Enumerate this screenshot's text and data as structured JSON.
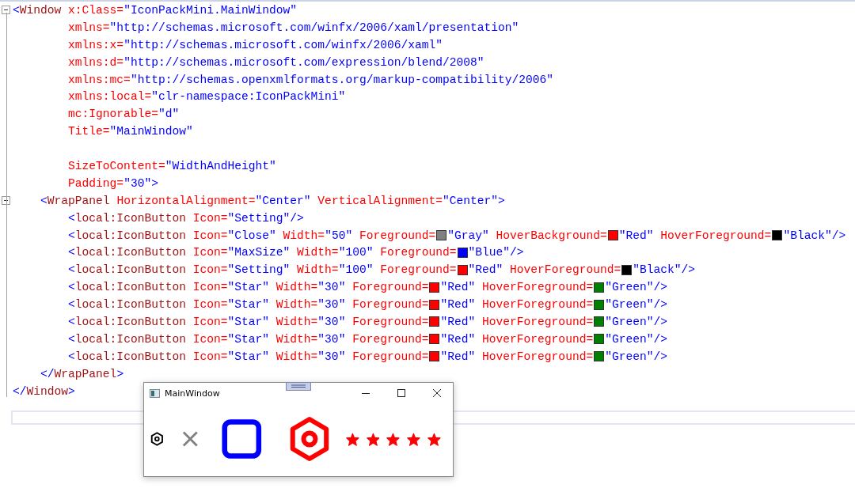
{
  "editor": {
    "lines": [
      {
        "kind": "code",
        "foldable": true,
        "tokens": [
          {
            "kind": "punct",
            "text": "<"
          },
          {
            "kind": "element",
            "text": "Window"
          },
          {
            "kind": "attr",
            "text": " x:Class="
          },
          {
            "kind": "value",
            "text": "\"IconPackMini.MainWindow\""
          }
        ]
      },
      {
        "kind": "code",
        "foldable": false,
        "tokens": [
          {
            "kind": "attr",
            "text": "        xmlns="
          },
          {
            "kind": "value",
            "text": "\"http://schemas.microsoft.com/winfx/2006/xaml/presentation\""
          }
        ]
      },
      {
        "kind": "code",
        "foldable": false,
        "tokens": [
          {
            "kind": "attr",
            "text": "        xmlns:x="
          },
          {
            "kind": "value",
            "text": "\"http://schemas.microsoft.com/winfx/2006/xaml\""
          }
        ]
      },
      {
        "kind": "code",
        "foldable": false,
        "tokens": [
          {
            "kind": "attr",
            "text": "        xmlns:d="
          },
          {
            "kind": "value",
            "text": "\"http://schemas.microsoft.com/expression/blend/2008\""
          }
        ]
      },
      {
        "kind": "code",
        "foldable": false,
        "tokens": [
          {
            "kind": "attr",
            "text": "        xmlns:mc="
          },
          {
            "kind": "value",
            "text": "\"http://schemas.openxmlformats.org/markup-compatibility/2006\""
          }
        ]
      },
      {
        "kind": "code",
        "foldable": false,
        "tokens": [
          {
            "kind": "attr",
            "text": "        xmlns:local="
          },
          {
            "kind": "value",
            "text": "\"clr-namespace:IconPackMini\""
          }
        ]
      },
      {
        "kind": "code",
        "foldable": false,
        "tokens": [
          {
            "kind": "attr",
            "text": "        mc:Ignorable="
          },
          {
            "kind": "value",
            "text": "\"d\""
          }
        ]
      },
      {
        "kind": "code",
        "foldable": false,
        "tokens": [
          {
            "kind": "attr",
            "text": "        Title="
          },
          {
            "kind": "value",
            "text": "\"MainWindow\""
          }
        ]
      },
      {
        "kind": "blank"
      },
      {
        "kind": "code",
        "foldable": false,
        "tokens": [
          {
            "kind": "attr",
            "text": "        SizeToContent="
          },
          {
            "kind": "value",
            "text": "\"WidthAndHeight\""
          }
        ]
      },
      {
        "kind": "code",
        "foldable": false,
        "tokens": [
          {
            "kind": "attr",
            "text": "        Padding="
          },
          {
            "kind": "value",
            "text": "\"30\""
          },
          {
            "kind": "punct",
            "text": ">"
          }
        ]
      },
      {
        "kind": "code",
        "foldable": true,
        "tokens": [
          {
            "kind": "punct",
            "text": "    <"
          },
          {
            "kind": "element",
            "text": "WrapPanel"
          },
          {
            "kind": "attr",
            "text": " HorizontalAlignment="
          },
          {
            "kind": "value",
            "text": "\"Center\""
          },
          {
            "kind": "attr",
            "text": " VerticalAlignment="
          },
          {
            "kind": "value",
            "text": "\"Center\""
          },
          {
            "kind": "punct",
            "text": ">"
          }
        ]
      },
      {
        "kind": "code",
        "foldable": false,
        "tokens": [
          {
            "kind": "punct",
            "text": "        <"
          },
          {
            "kind": "element",
            "text": "local:IconButton"
          },
          {
            "kind": "attr",
            "text": " Icon="
          },
          {
            "kind": "value",
            "text": "\"Setting\""
          },
          {
            "kind": "punct",
            "text": "/>"
          }
        ]
      },
      {
        "kind": "code",
        "foldable": false,
        "tokens": [
          {
            "kind": "punct",
            "text": "        <"
          },
          {
            "kind": "element",
            "text": "local:IconButton"
          },
          {
            "kind": "attr",
            "text": " Icon="
          },
          {
            "kind": "value",
            "text": "\"Close\""
          },
          {
            "kind": "attr",
            "text": " Width="
          },
          {
            "kind": "value",
            "text": "\"50\""
          },
          {
            "kind": "attr",
            "text": " Foreground="
          },
          {
            "kind": "swatch",
            "color": "#808080"
          },
          {
            "kind": "value",
            "text": "\"Gray\""
          },
          {
            "kind": "attr",
            "text": " HoverBackground="
          },
          {
            "kind": "swatch",
            "color": "#ff0000"
          },
          {
            "kind": "value",
            "text": "\"Red\""
          },
          {
            "kind": "attr",
            "text": " HoverForeground="
          },
          {
            "kind": "swatch",
            "color": "#000000"
          },
          {
            "kind": "value",
            "text": "\"Black\""
          },
          {
            "kind": "punct",
            "text": "/>"
          }
        ]
      },
      {
        "kind": "code",
        "foldable": false,
        "tokens": [
          {
            "kind": "punct",
            "text": "        <"
          },
          {
            "kind": "element",
            "text": "local:IconButton"
          },
          {
            "kind": "attr",
            "text": " Icon="
          },
          {
            "kind": "value",
            "text": "\"MaxSize\""
          },
          {
            "kind": "attr",
            "text": " Width="
          },
          {
            "kind": "value",
            "text": "\"100\""
          },
          {
            "kind": "attr",
            "text": " Foreground="
          },
          {
            "kind": "swatch",
            "color": "#0000ff"
          },
          {
            "kind": "value",
            "text": "\"Blue\""
          },
          {
            "kind": "punct",
            "text": "/>"
          }
        ]
      },
      {
        "kind": "code",
        "foldable": false,
        "tokens": [
          {
            "kind": "punct",
            "text": "        <"
          },
          {
            "kind": "element",
            "text": "local:IconButton"
          },
          {
            "kind": "attr",
            "text": " Icon="
          },
          {
            "kind": "value",
            "text": "\"Setting\""
          },
          {
            "kind": "attr",
            "text": " Width="
          },
          {
            "kind": "value",
            "text": "\"100\""
          },
          {
            "kind": "attr",
            "text": " Foreground="
          },
          {
            "kind": "swatch",
            "color": "#ff0000"
          },
          {
            "kind": "value",
            "text": "\"Red\""
          },
          {
            "kind": "attr",
            "text": " HoverForeground="
          },
          {
            "kind": "swatch",
            "color": "#000000"
          },
          {
            "kind": "value",
            "text": "\"Black\""
          },
          {
            "kind": "punct",
            "text": "/>"
          }
        ]
      },
      {
        "kind": "code",
        "foldable": false,
        "tokens": [
          {
            "kind": "punct",
            "text": "        <"
          },
          {
            "kind": "element",
            "text": "local:IconButton"
          },
          {
            "kind": "attr",
            "text": " Icon="
          },
          {
            "kind": "value",
            "text": "\"Star\""
          },
          {
            "kind": "attr",
            "text": " Width="
          },
          {
            "kind": "value",
            "text": "\"30\""
          },
          {
            "kind": "attr",
            "text": " Foreground="
          },
          {
            "kind": "swatch",
            "color": "#ff0000"
          },
          {
            "kind": "value",
            "text": "\"Red\""
          },
          {
            "kind": "attr",
            "text": " HoverForeground="
          },
          {
            "kind": "swatch",
            "color": "#008000"
          },
          {
            "kind": "value",
            "text": "\"Green\""
          },
          {
            "kind": "punct",
            "text": "/>"
          }
        ]
      },
      {
        "kind": "code",
        "foldable": false,
        "tokens": [
          {
            "kind": "punct",
            "text": "        <"
          },
          {
            "kind": "element",
            "text": "local:IconButton"
          },
          {
            "kind": "attr",
            "text": " Icon="
          },
          {
            "kind": "value",
            "text": "\"Star\""
          },
          {
            "kind": "attr",
            "text": " Width="
          },
          {
            "kind": "value",
            "text": "\"30\""
          },
          {
            "kind": "attr",
            "text": " Foreground="
          },
          {
            "kind": "swatch",
            "color": "#ff0000"
          },
          {
            "kind": "value",
            "text": "\"Red\""
          },
          {
            "kind": "attr",
            "text": " HoverForeground="
          },
          {
            "kind": "swatch",
            "color": "#008000"
          },
          {
            "kind": "value",
            "text": "\"Green\""
          },
          {
            "kind": "punct",
            "text": "/>"
          }
        ]
      },
      {
        "kind": "code",
        "foldable": false,
        "tokens": [
          {
            "kind": "punct",
            "text": "        <"
          },
          {
            "kind": "element",
            "text": "local:IconButton"
          },
          {
            "kind": "attr",
            "text": " Icon="
          },
          {
            "kind": "value",
            "text": "\"Star\""
          },
          {
            "kind": "attr",
            "text": " Width="
          },
          {
            "kind": "value",
            "text": "\"30\""
          },
          {
            "kind": "attr",
            "text": " Foreground="
          },
          {
            "kind": "swatch",
            "color": "#ff0000"
          },
          {
            "kind": "value",
            "text": "\"Red\""
          },
          {
            "kind": "attr",
            "text": " HoverForeground="
          },
          {
            "kind": "swatch",
            "color": "#008000"
          },
          {
            "kind": "value",
            "text": "\"Green\""
          },
          {
            "kind": "punct",
            "text": "/>"
          }
        ]
      },
      {
        "kind": "code",
        "foldable": false,
        "tokens": [
          {
            "kind": "punct",
            "text": "        <"
          },
          {
            "kind": "element",
            "text": "local:IconButton"
          },
          {
            "kind": "attr",
            "text": " Icon="
          },
          {
            "kind": "value",
            "text": "\"Star\""
          },
          {
            "kind": "attr",
            "text": " Width="
          },
          {
            "kind": "value",
            "text": "\"30\""
          },
          {
            "kind": "attr",
            "text": " Foreground="
          },
          {
            "kind": "swatch",
            "color": "#ff0000"
          },
          {
            "kind": "value",
            "text": "\"Red\""
          },
          {
            "kind": "attr",
            "text": " HoverForeground="
          },
          {
            "kind": "swatch",
            "color": "#008000"
          },
          {
            "kind": "value",
            "text": "\"Green\""
          },
          {
            "kind": "punct",
            "text": "/>"
          }
        ]
      },
      {
        "kind": "code",
        "foldable": false,
        "tokens": [
          {
            "kind": "punct",
            "text": "        <"
          },
          {
            "kind": "element",
            "text": "local:IconButton"
          },
          {
            "kind": "attr",
            "text": " Icon="
          },
          {
            "kind": "value",
            "text": "\"Star\""
          },
          {
            "kind": "attr",
            "text": " Width="
          },
          {
            "kind": "value",
            "text": "\"30\""
          },
          {
            "kind": "attr",
            "text": " Foreground="
          },
          {
            "kind": "swatch",
            "color": "#ff0000"
          },
          {
            "kind": "value",
            "text": "\"Red\""
          },
          {
            "kind": "attr",
            "text": " HoverForeground="
          },
          {
            "kind": "swatch",
            "color": "#008000"
          },
          {
            "kind": "value",
            "text": "\"Green\""
          },
          {
            "kind": "punct",
            "text": "/>"
          }
        ]
      },
      {
        "kind": "code",
        "foldable": false,
        "tokens": [
          {
            "kind": "punct",
            "text": "    </"
          },
          {
            "kind": "element",
            "text": "WrapPanel"
          },
          {
            "kind": "punct",
            "text": ">"
          }
        ]
      },
      {
        "kind": "code",
        "foldable": false,
        "tokens": [
          {
            "kind": "punct",
            "text": "</"
          },
          {
            "kind": "element",
            "text": "Window"
          },
          {
            "kind": "punct",
            "text": ">"
          }
        ]
      }
    ]
  },
  "preview_window": {
    "title": "MainWindow",
    "icons": [
      {
        "kind": "gear",
        "color": "#000000"
      },
      {
        "kind": "cross",
        "color": "#808080"
      },
      {
        "kind": "square",
        "color": "#0000ff"
      },
      {
        "kind": "gear-large",
        "color": "#ff0000"
      },
      {
        "kind": "star",
        "color": "#ff0000"
      },
      {
        "kind": "star",
        "color": "#ff0000"
      },
      {
        "kind": "star",
        "color": "#ff0000"
      },
      {
        "kind": "star",
        "color": "#ff0000"
      },
      {
        "kind": "star",
        "color": "#ff0000"
      }
    ]
  }
}
